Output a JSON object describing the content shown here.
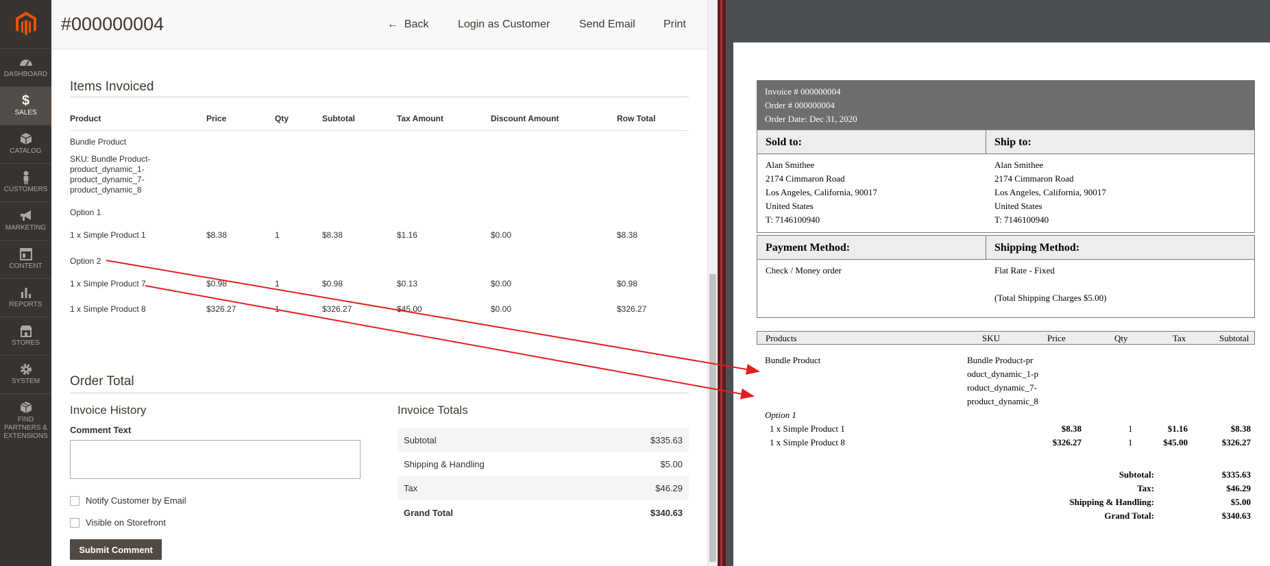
{
  "sidebar": {
    "items": [
      {
        "label": "DASHBOARD",
        "icon": "dashboard-icon"
      },
      {
        "label": "SALES",
        "icon": "dollar-icon"
      },
      {
        "label": "CATALOG",
        "icon": "box-icon"
      },
      {
        "label": "CUSTOMERS",
        "icon": "person-icon"
      },
      {
        "label": "MARKETING",
        "icon": "megaphone-icon"
      },
      {
        "label": "CONTENT",
        "icon": "layout-icon"
      },
      {
        "label": "REPORTS",
        "icon": "bar-chart-icon"
      },
      {
        "label": "STORES",
        "icon": "store-icon"
      },
      {
        "label": "SYSTEM",
        "icon": "gear-icon"
      },
      {
        "label": "FIND PARTNERS & EXTENSIONS",
        "icon": "cube-icon"
      }
    ]
  },
  "header": {
    "title": "#000000004",
    "back": "Back",
    "login_as_customer": "Login as Customer",
    "send_email": "Send Email",
    "print": "Print"
  },
  "items_invoiced": {
    "title": "Items Invoiced",
    "columns": [
      "Product",
      "Price",
      "Qty",
      "Subtotal",
      "Tax Amount",
      "Discount Amount",
      "Row Total"
    ],
    "bundle_name": "Bundle Product",
    "sku_lines": [
      "SKU: Bundle Product-",
      "product_dynamic_1-",
      "product_dynamic_7-",
      "product_dynamic_8"
    ],
    "option1": "Option 1",
    "option2": "Option 2",
    "rows": [
      [
        "1 x Simple Product 1",
        "$8.38",
        "1",
        "$8.38",
        "$1.16",
        "$0.00",
        "$8.38"
      ],
      [
        "1 x Simple Product 7",
        "$0.98",
        "1",
        "$0.98",
        "$0.13",
        "$0.00",
        "$0.98"
      ],
      [
        "1 x Simple Product 8",
        "$326.27",
        "1",
        "$326.27",
        "$45.00",
        "$0.00",
        "$326.27"
      ]
    ]
  },
  "order_total": {
    "title": "Order Total",
    "history_title": "Invoice History",
    "comment_label": "Comment Text",
    "comment_value": "",
    "notify_label": "Notify Customer by Email",
    "visible_label": "Visible on Storefront",
    "submit": "Submit Comment",
    "totals_title": "Invoice Totals",
    "totals": [
      {
        "label": "Subtotal",
        "value": "$335.63"
      },
      {
        "label": "Shipping & Handling",
        "value": "$5.00"
      },
      {
        "label": "Tax",
        "value": "$46.29"
      },
      {
        "label": "Grand Total",
        "value": "$340.63"
      }
    ]
  },
  "pdf": {
    "invoice_no": "Invoice # 000000004",
    "order_no": "Order # 000000004",
    "order_date": "Order Date: Dec 31, 2020",
    "sold_to": "Sold to:",
    "ship_to": "Ship to:",
    "address": [
      "Alan Smithee",
      "2174 Cimmaron Road",
      "Los Angeles, California, 90017",
      "United States",
      "T: 7146100940"
    ],
    "payment_method": "Payment Method:",
    "shipping_method": "Shipping Method:",
    "payment_value": "Check / Money order",
    "shipping_value": "Flat Rate - Fixed",
    "shipping_charges": "(Total Shipping Charges $5.00)",
    "product_columns": [
      "Products",
      "SKU",
      "Price",
      "Qty",
      "Tax",
      "Subtotal"
    ],
    "bundle_name": "Bundle Product",
    "sku_lines": [
      "Bundle Product-pr",
      "oduct_dynamic_1-p",
      "roduct_dynamic_7-",
      "product_dynamic_8"
    ],
    "option1": "Option 1",
    "rows": [
      [
        "1 x Simple Product 1",
        "$8.38",
        "1",
        "$1.16",
        "$8.38"
      ],
      [
        "1 x Simple Product 8",
        "$326.27",
        "1",
        "$45.00",
        "$326.27"
      ]
    ],
    "totals": [
      {
        "label": "Subtotal:",
        "value": "$335.63"
      },
      {
        "label": "Tax:",
        "value": "$46.29"
      },
      {
        "label": "Shipping & Handling:",
        "value": "$5.00"
      },
      {
        "label": "Grand Total:",
        "value": "$340.63"
      }
    ]
  },
  "colors": {
    "sidebar_bg": "#373330",
    "button_bg": "#514943",
    "annotation_arrow": "#e02020"
  }
}
